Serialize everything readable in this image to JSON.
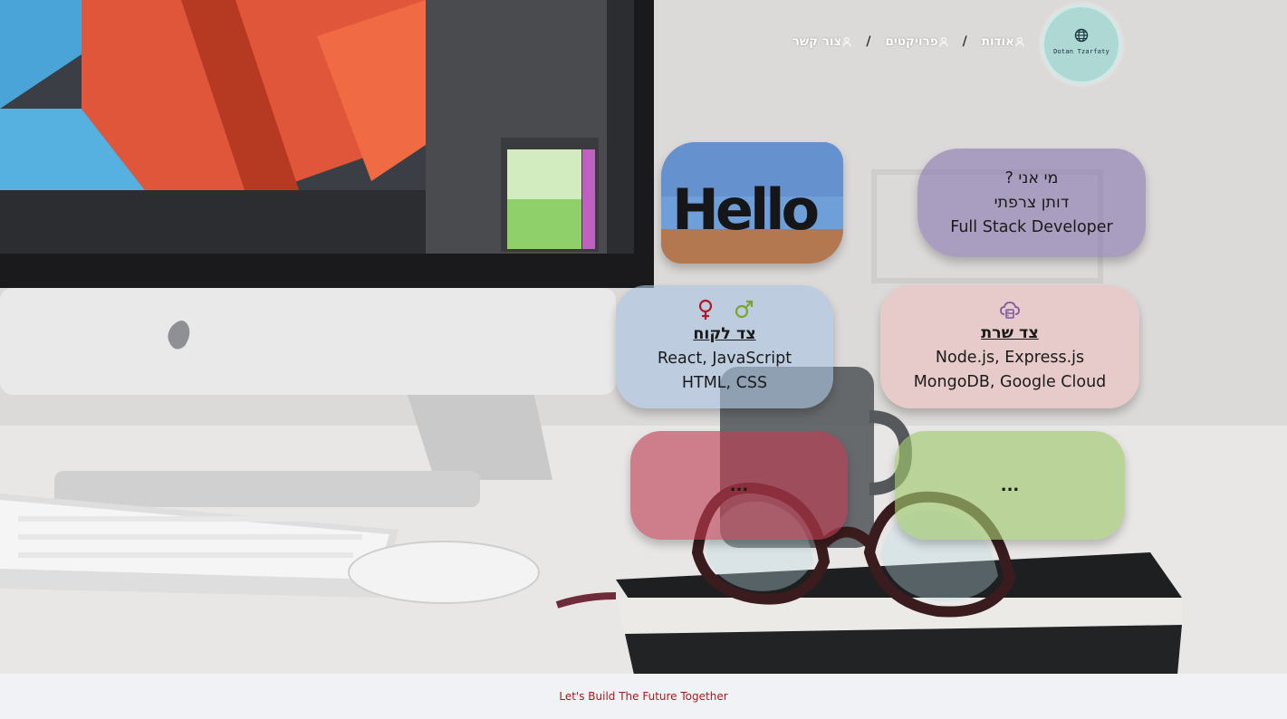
{
  "logo": {
    "text": "Dotan Tzarfaty",
    "icon": "globe-icon"
  },
  "nav": {
    "items": [
      {
        "label": "אודות",
        "icon": "person-icon"
      },
      {
        "label": "פרויקטים",
        "icon": "person-icon"
      },
      {
        "label": "צור קשר",
        "icon": "person-icon"
      }
    ],
    "separator": "/"
  },
  "about_card": {
    "line1": "מי אני ?",
    "line2": "דותן צרפתי",
    "line3": "Full Stack Developer"
  },
  "hello_card": {
    "image_text": "Hello"
  },
  "server_card": {
    "icon": "cloud-server-icon",
    "title": "צד שרת",
    "line1": "Node.js, Express.js",
    "line2": "MongoDB, Google Cloud"
  },
  "client_card": {
    "icons": [
      "female-icon",
      "male-icon"
    ],
    "title": "צד לקוח",
    "line1": "React, JavaScript",
    "line2": "HTML, CSS"
  },
  "more_card_1": {
    "text": "..."
  },
  "more_card_2": {
    "text": "..."
  },
  "footer": {
    "text": "Let's Build The Future Together"
  },
  "colors": {
    "footer_text": "#9e1b1b",
    "footer_bg": "#f1f2f5",
    "about_bg": "#806eaa",
    "server_bg": "#ecc4c4",
    "client_bg": "#aac3e1",
    "more1_bg": "#be3c50",
    "more2_bg": "#a0c86e",
    "logo_bg": "#a5d7d2"
  }
}
